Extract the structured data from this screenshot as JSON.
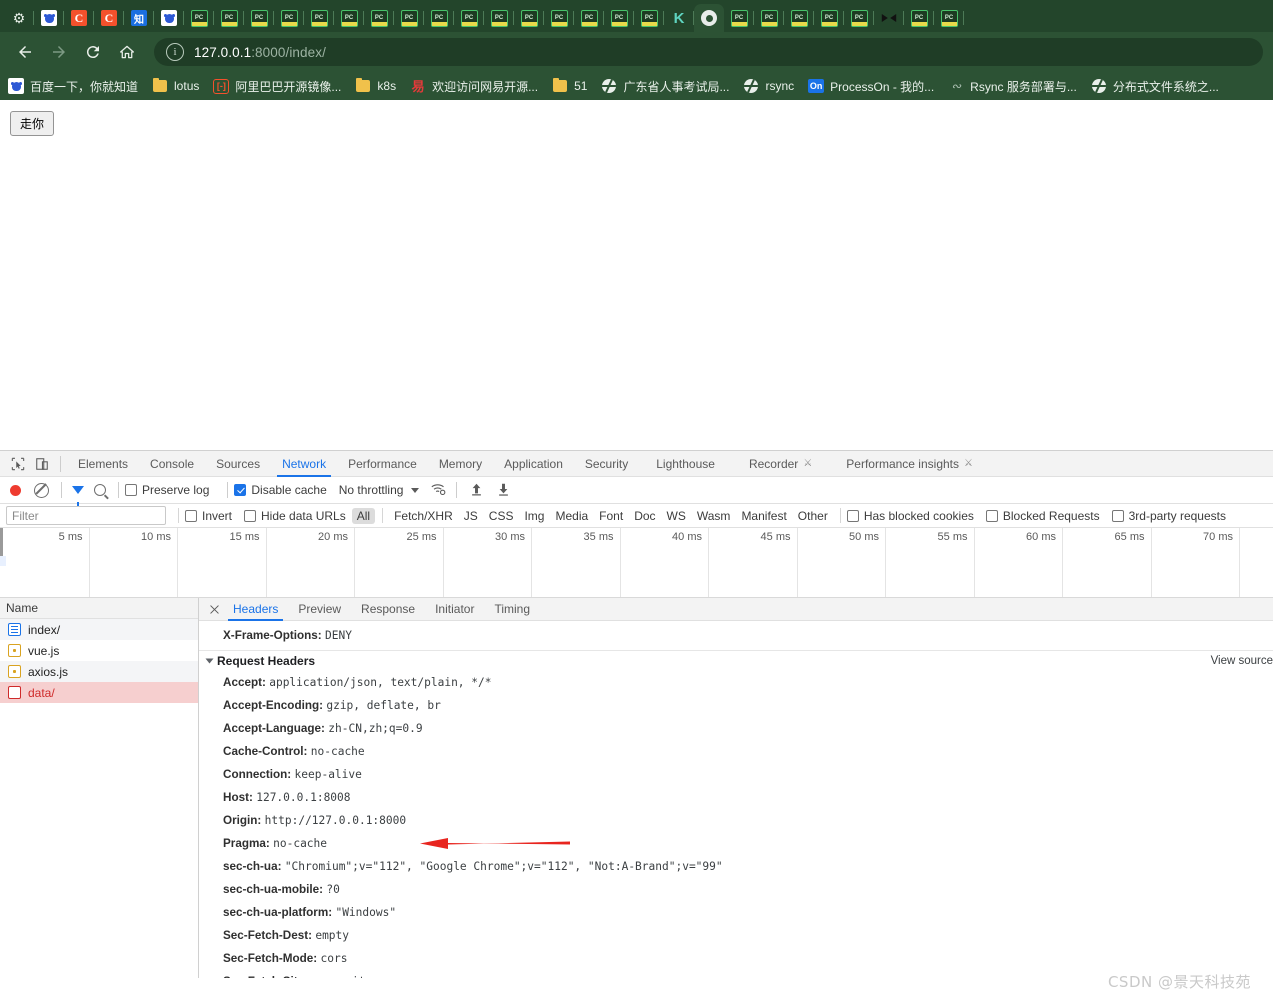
{
  "browser": {
    "tabs": [
      {
        "icon": "gear-icon",
        "kind": "gear"
      },
      {
        "icon": "baidu-icon",
        "kind": "baidu"
      },
      {
        "icon": "csdn-icon",
        "kind": "c"
      },
      {
        "icon": "csdn-icon",
        "kind": "c"
      },
      {
        "icon": "zhihu-icon",
        "kind": "zhi"
      },
      {
        "icon": "baidu-icon",
        "kind": "baidu"
      },
      {
        "icon": "pycharm-icon",
        "kind": "pc"
      },
      {
        "icon": "pycharm-icon",
        "kind": "pc"
      },
      {
        "icon": "pycharm-icon",
        "kind": "pc"
      },
      {
        "icon": "pycharm-icon",
        "kind": "pc"
      },
      {
        "icon": "pycharm-icon",
        "kind": "pc"
      },
      {
        "icon": "pycharm-icon",
        "kind": "pc"
      },
      {
        "icon": "pycharm-icon",
        "kind": "pc"
      },
      {
        "icon": "pycharm-icon",
        "kind": "pc"
      },
      {
        "icon": "pycharm-icon",
        "kind": "pc"
      },
      {
        "icon": "pycharm-icon",
        "kind": "pc"
      },
      {
        "icon": "pycharm-icon",
        "kind": "pc"
      },
      {
        "icon": "pycharm-icon",
        "kind": "pc"
      },
      {
        "icon": "pycharm-icon",
        "kind": "pc"
      },
      {
        "icon": "pycharm-icon",
        "kind": "pc"
      },
      {
        "icon": "pycharm-icon",
        "kind": "pc"
      },
      {
        "icon": "pycharm-icon",
        "kind": "pc"
      },
      {
        "icon": "kubernetes-icon",
        "kind": "k"
      },
      {
        "icon": "chrome-icon",
        "kind": "chrome"
      },
      {
        "icon": "pycharm-icon",
        "kind": "pc"
      },
      {
        "icon": "pycharm-icon",
        "kind": "pc"
      },
      {
        "icon": "pycharm-icon",
        "kind": "pc"
      },
      {
        "icon": "pycharm-icon",
        "kind": "pc"
      },
      {
        "icon": "pycharm-icon",
        "kind": "pc"
      },
      {
        "icon": "bowtie-icon",
        "kind": "bow"
      },
      {
        "icon": "pycharm-icon",
        "kind": "pc"
      },
      {
        "icon": "pycharm-icon",
        "kind": "pc"
      }
    ],
    "nav": {
      "back": "back-arrow",
      "forward": "forward-arrow",
      "reload": "reload-icon",
      "home": "home-icon"
    },
    "url": {
      "host": "127.0.0.1",
      "rest": ":8000/index/"
    },
    "bookmarks": [
      {
        "label": "百度一下，你就知道",
        "icon": "baidu-icon"
      },
      {
        "label": "lotus",
        "icon": "folder-icon"
      },
      {
        "label": "阿里巴巴开源镜像...",
        "icon": "alibaba-icon"
      },
      {
        "label": "k8s",
        "icon": "folder-icon"
      },
      {
        "label": "欢迎访问网易开源...",
        "icon": "netease-icon"
      },
      {
        "label": "51",
        "icon": "folder-icon"
      },
      {
        "label": "广东省人事考试局...",
        "icon": "globe-icon"
      },
      {
        "label": "rsync",
        "icon": "globe-icon"
      },
      {
        "label": "ProcessOn - 我的...",
        "icon": "processon-icon"
      },
      {
        "label": "Rsync 服务部署与...",
        "icon": "rsync-icon"
      },
      {
        "label": "分布式文件系统之...",
        "icon": "globe-icon"
      }
    ]
  },
  "page": {
    "go_button": "走你"
  },
  "devtools": {
    "panels": [
      "Elements",
      "Console",
      "Sources",
      "Network",
      "Performance",
      "Memory",
      "Application",
      "Security",
      "Lighthouse",
      "Recorder",
      "Performance insights"
    ],
    "selected_panel": "Network",
    "experimental_panels": [
      "Recorder",
      "Performance insights"
    ],
    "toolbar": {
      "record": "record-button",
      "clear": "clear-button",
      "filter": "filter-toggle",
      "search": "search-toggle",
      "preserve_log": {
        "label": "Preserve log",
        "checked": false
      },
      "disable_cache": {
        "label": "Disable cache",
        "checked": true
      },
      "throttling": "No throttling",
      "network_conditions": "wifi-settings-icon",
      "import_har": "import-har-icon",
      "export_har": "export-har-icon"
    },
    "filterbar": {
      "filter_value": "",
      "filter_placeholder": "Filter",
      "invert": {
        "label": "Invert",
        "checked": false
      },
      "hide_data_urls": {
        "label": "Hide data URLs",
        "checked": false
      },
      "types": [
        "All",
        "Fetch/XHR",
        "JS",
        "CSS",
        "Img",
        "Media",
        "Font",
        "Doc",
        "WS",
        "Wasm",
        "Manifest",
        "Other"
      ],
      "selected_type": "All",
      "has_blocked_cookies": {
        "label": "Has blocked cookies",
        "checked": false
      },
      "blocked_requests": {
        "label": "Blocked Requests",
        "checked": false
      },
      "third_party": {
        "label": "3rd-party requests",
        "checked": false
      }
    },
    "timeline": {
      "ticks": [
        "5 ms",
        "10 ms",
        "15 ms",
        "20 ms",
        "25 ms",
        "30 ms",
        "35 ms",
        "40 ms",
        "45 ms",
        "50 ms",
        "55 ms",
        "60 ms",
        "65 ms",
        "70 ms"
      ]
    },
    "requests": {
      "column": "Name",
      "rows": [
        {
          "name": "index/",
          "type": "doc",
          "selected": false
        },
        {
          "name": "vue.js",
          "type": "js",
          "selected": false
        },
        {
          "name": "axios.js",
          "type": "js",
          "selected": false
        },
        {
          "name": "data/",
          "type": "xhr",
          "selected": true
        }
      ]
    },
    "detail": {
      "tabs": [
        "Headers",
        "Preview",
        "Response",
        "Initiator",
        "Timing"
      ],
      "selected_tab": "Headers",
      "view_source": "View source",
      "top_header": {
        "name": "X-Frame-Options:",
        "value": "DENY"
      },
      "section_title": "Request Headers",
      "request_headers": [
        {
          "name": "Accept:",
          "value": "application/json, text/plain, */*"
        },
        {
          "name": "Accept-Encoding:",
          "value": "gzip, deflate, br"
        },
        {
          "name": "Accept-Language:",
          "value": "zh-CN,zh;q=0.9"
        },
        {
          "name": "Cache-Control:",
          "value": "no-cache"
        },
        {
          "name": "Connection:",
          "value": "keep-alive"
        },
        {
          "name": "Host:",
          "value": "127.0.0.1:8008"
        },
        {
          "name": "Origin:",
          "value": "http://127.0.0.1:8000"
        },
        {
          "name": "Pragma:",
          "value": "no-cache"
        },
        {
          "name": "sec-ch-ua:",
          "value": "\"Chromium\";v=\"112\", \"Google Chrome\";v=\"112\", \"Not:A-Brand\";v=\"99\""
        },
        {
          "name": "sec-ch-ua-mobile:",
          "value": "?0"
        },
        {
          "name": "sec-ch-ua-platform:",
          "value": "\"Windows\""
        },
        {
          "name": "Sec-Fetch-Dest:",
          "value": "empty"
        },
        {
          "name": "Sec-Fetch-Mode:",
          "value": "cors"
        },
        {
          "name": "Sec-Fetch-Site:",
          "value": "same-site"
        }
      ]
    }
  },
  "annotation": {
    "arrow": "red-arrow-pointing-to-origin-header",
    "color": "#e8251f"
  },
  "watermark": "CSDN @景天科技苑"
}
